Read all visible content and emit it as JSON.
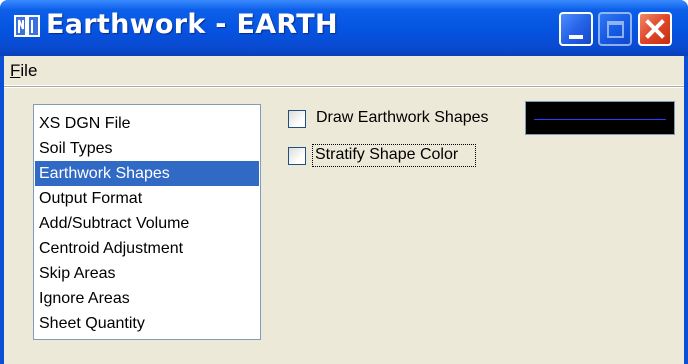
{
  "window": {
    "title": "Earthwork - EARTH"
  },
  "menu": {
    "file_label": "F",
    "file_label_rest": "ile"
  },
  "listbox": {
    "items": [
      "XS DGN File",
      "Soil Types",
      "Earthwork Shapes",
      "Output Format",
      "Add/Subtract Volume",
      "Centroid Adjustment",
      "Skip Areas",
      "Ignore Areas",
      "Sheet Quantity"
    ],
    "selected_index": 2
  },
  "options": {
    "draw_shapes_label": "Draw Earthwork Shapes",
    "draw_shapes_checked": false,
    "stratify_label": "Stratify Shape Color",
    "stratify_checked": false,
    "shape_color": "#000000",
    "shape_line_color": "#2a3cff"
  },
  "colors": {
    "titlebar": "#0553e1",
    "dialog_bg": "#ece9d8",
    "selection": "#316ac5"
  }
}
